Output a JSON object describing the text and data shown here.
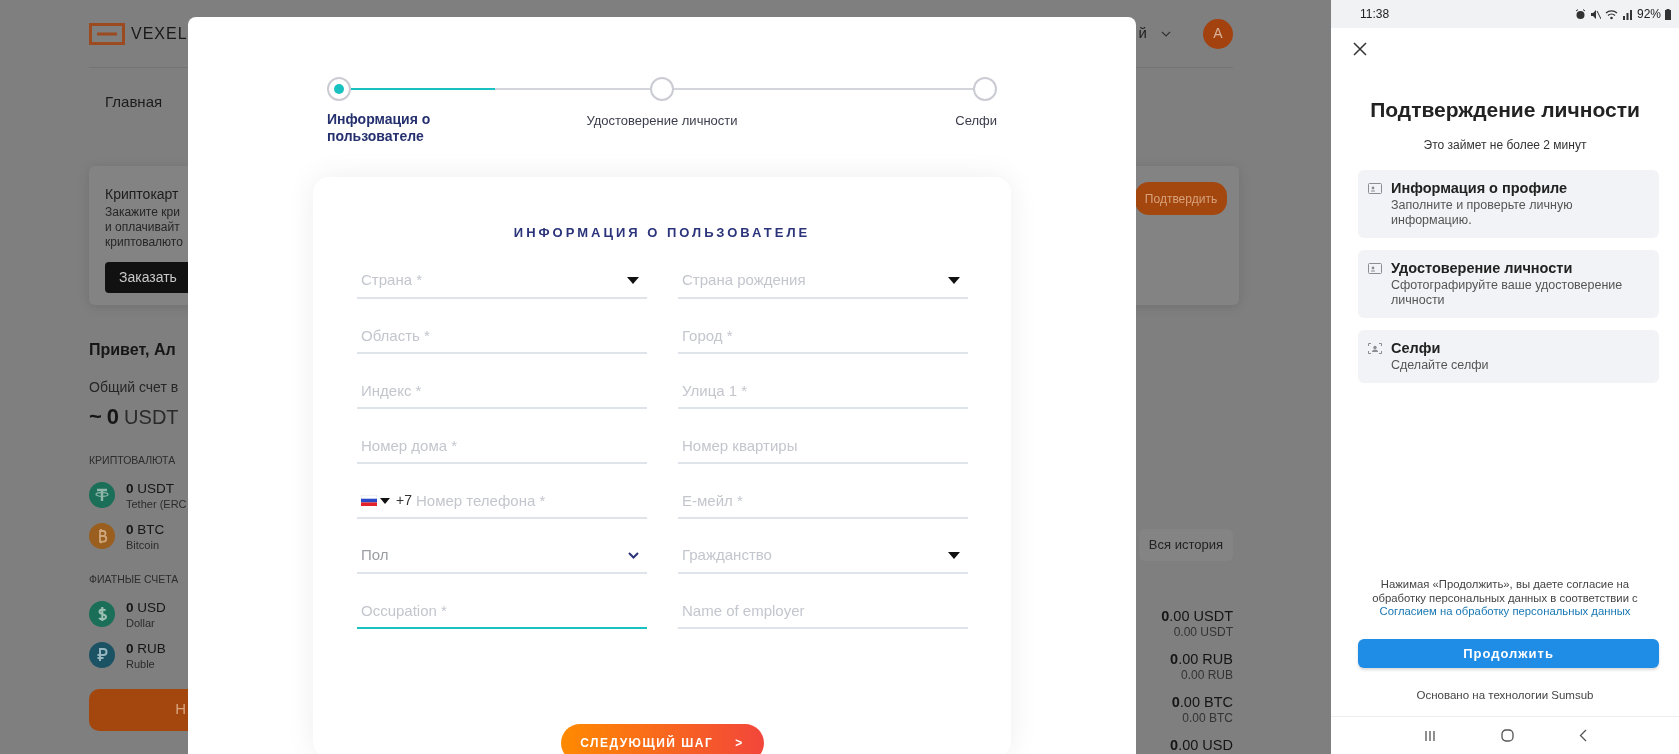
{
  "background_page": {
    "logo": "VEXEL",
    "header_text": "й",
    "avatar": "A",
    "nav": [
      {
        "label": "Главная"
      }
    ],
    "promo": {
      "title": "Криптокарт",
      "lines": [
        "Закажите кри",
        "и оплачивайт",
        "криптовалюто"
      ],
      "order_button": "Заказать",
      "confirm_button": "Подтвердить"
    },
    "greeting": "Привет, Ал",
    "total_label": "Общий счет в",
    "total_prefix": "~",
    "total_amount": "0",
    "total_currency": "USDT",
    "groups": [
      {
        "title": "КРИПТОВАЛЮТА",
        "accounts": [
          {
            "kind": "tether",
            "amount": "0",
            "currency": "USDT",
            "name": "Tether (ERC"
          },
          {
            "kind": "bitcoin",
            "amount": "0",
            "currency": "BTC",
            "name": "Bitcoin"
          }
        ]
      },
      {
        "title": "ФИАТНЫЕ СЧЕТА",
        "accounts": [
          {
            "kind": "dollar",
            "amount": "0",
            "currency": "USD",
            "name": "Dollar"
          },
          {
            "kind": "ruble",
            "amount": "0",
            "currency": "RUB",
            "name": "Ruble"
          }
        ]
      }
    ],
    "action_button": "Н",
    "history_button": "Вся история",
    "balances": [
      {
        "amount": "**0**.00 USDT",
        "converted": "0.00 USDT"
      },
      {
        "amount": "**0**.00 RUB",
        "converted": "0.00 RUB"
      },
      {
        "amount": "**0**.00 BTC",
        "converted": "0.00 BTC"
      },
      {
        "amount": "**0**.00 USD"
      }
    ]
  },
  "modal": {
    "stepper": {
      "connectors": [
        {
          "level": 0.48
        },
        {
          "level": 0
        }
      ],
      "steps": [
        {
          "label": "Информация о пользователе",
          "selected": true
        },
        {
          "label": "Удостоверение личности",
          "selected": false
        },
        {
          "label": "Селфи",
          "selected": false
        }
      ]
    },
    "form": {
      "title": "ИНФОРМАЦИЯ О ПОЛЬЗОВАТЕЛЕ",
      "fields": [
        {
          "kind": "select",
          "placeholder": "Страна *",
          "focused": false
        },
        {
          "kind": "select",
          "placeholder": "Страна рождения",
          "focused": false
        },
        {
          "kind": "text",
          "placeholder": "Область *",
          "focused": false
        },
        {
          "kind": "text",
          "placeholder": "Город *",
          "focused": false
        },
        {
          "kind": "text",
          "placeholder": "Индекс *",
          "focused": false
        },
        {
          "kind": "text",
          "placeholder": "Улица 1 *",
          "focused": false
        },
        {
          "kind": "text",
          "placeholder": "Номер дома *",
          "focused": false
        },
        {
          "kind": "text",
          "placeholder": "Номер квартиры",
          "focused": false
        },
        {
          "kind": "phone",
          "dial_code": "+7",
          "placeholder": "Номер телефона *",
          "focused": false
        },
        {
          "kind": "text",
          "placeholder": "Е-мейл *",
          "focused": false
        },
        {
          "kind": "dropdown",
          "placeholder": "Пол",
          "focused": false
        },
        {
          "kind": "select",
          "placeholder": "Гражданство",
          "focused": false
        },
        {
          "kind": "text",
          "placeholder": "Occupation *",
          "focused": true
        },
        {
          "kind": "text",
          "placeholder": "Name of employer",
          "focused": false
        }
      ],
      "next_button": {
        "label": "СЛЕДУЮЩИЙ ШАГ",
        "arrow": ">"
      }
    }
  },
  "phone": {
    "status_bar": {
      "time": "11:38",
      "battery": "92%"
    },
    "title": "Подтверждение личности",
    "subtitle": "Это займет не более 2 минут",
    "steps": [
      {
        "kind": "document",
        "title": "Информация о профиле",
        "description": "Заполните и проверьте личную информацию."
      },
      {
        "kind": "document",
        "title": "Удостоверение личности",
        "description": "Сфотографируйте ваше удостоверение личности"
      },
      {
        "kind": "selfie",
        "title": "Селфи",
        "description": "Сделайте селфи"
      }
    ],
    "consent": "Нажимая «Продолжить», вы даете согласие на обработку персональных данных в соответствии с",
    "consent_link": "Согласием на обработку персональных данных",
    "continue_button": "Продолжить",
    "powered_by": "Основано на технологии Sumsub"
  }
}
